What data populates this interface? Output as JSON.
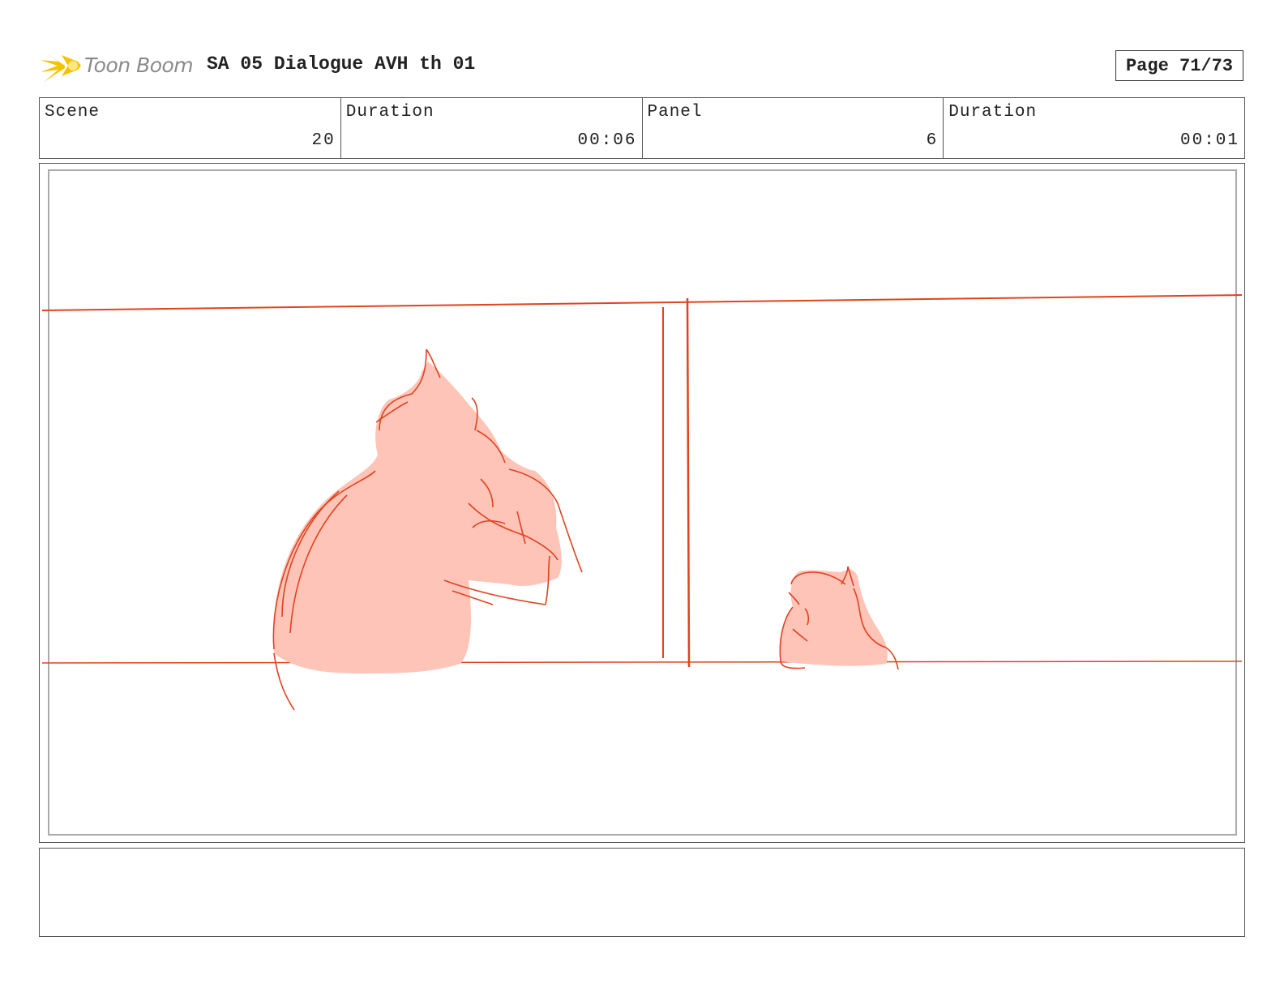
{
  "header": {
    "logo_text": "Toon Boom",
    "project_title": "SA 05 Dialogue AVH th 01",
    "page_label": "Page 71/73"
  },
  "info": {
    "scene_label": "Scene",
    "scene_value": "20",
    "scene_duration_label": "Duration",
    "scene_duration_value": "00:06",
    "panel_label": "Panel",
    "panel_value": "6",
    "panel_duration_label": "Duration",
    "panel_duration_value": "00:01"
  },
  "notes": {
    "text": ""
  },
  "colors": {
    "sketch_line": "#e0431f",
    "sketch_fill": "#ffc4b8",
    "logo_yellow": "#f5c200"
  },
  "icons": {
    "logo": "starburst-logo-icon"
  }
}
